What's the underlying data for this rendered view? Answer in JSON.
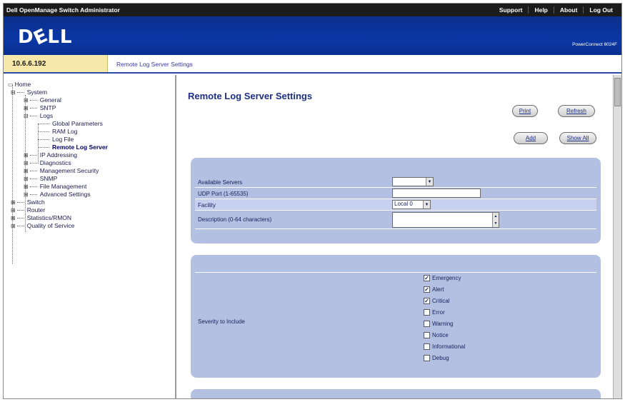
{
  "topbar": {
    "title": "Dell OpenManage Switch Administrator",
    "links": [
      "Support",
      "Help",
      "About",
      "Log Out"
    ]
  },
  "brand": {
    "logo": "DɛLL",
    "tagline": "PowerConnect 6024F"
  },
  "ip": "10.6.6.192",
  "breadcrumb": "Remote Log Server Settings",
  "tree": {
    "home": "Home",
    "system": "System",
    "general": "General",
    "sntp": "SNTP",
    "logs": "Logs",
    "global_parameters": "Global Parameters",
    "ram_log": "RAM Log",
    "log_file": "Log File",
    "remote_log_server": "Remote Log Server",
    "ip_addressing": "IP Addressing",
    "diagnostics": "Diagnostics",
    "management_security": "Management Security",
    "snmp": "SNMP",
    "file_management": "File Management",
    "advanced_settings": "Advanced Settings",
    "switch": "Switch",
    "router": "Router",
    "statistics_rmon": "Statistics/RMON",
    "quality_of_service": "Quality of Service"
  },
  "page": {
    "title": "Remote Log Server Settings",
    "buttons": {
      "print": "Print",
      "refresh": "Refresh",
      "add": "Add",
      "show_all": "Show All"
    }
  },
  "form": {
    "available_servers": {
      "label": "Available Servers",
      "value": ""
    },
    "udp_port": {
      "label": "UDP Port (1-65535)",
      "value": ""
    },
    "facility": {
      "label": "Facility",
      "value": "Local 0"
    },
    "description": {
      "label": "Description (0-64 characters)",
      "value": ""
    }
  },
  "severity": {
    "label": "Severity to Include",
    "options": [
      {
        "label": "Emergency",
        "checked": true
      },
      {
        "label": "Alert",
        "checked": true
      },
      {
        "label": "Critical",
        "checked": true
      },
      {
        "label": "Error",
        "checked": false
      },
      {
        "label": "Warning",
        "checked": false
      },
      {
        "label": "Notice",
        "checked": false
      },
      {
        "label": "Informational",
        "checked": false
      },
      {
        "label": "Debug",
        "checked": false
      }
    ]
  }
}
